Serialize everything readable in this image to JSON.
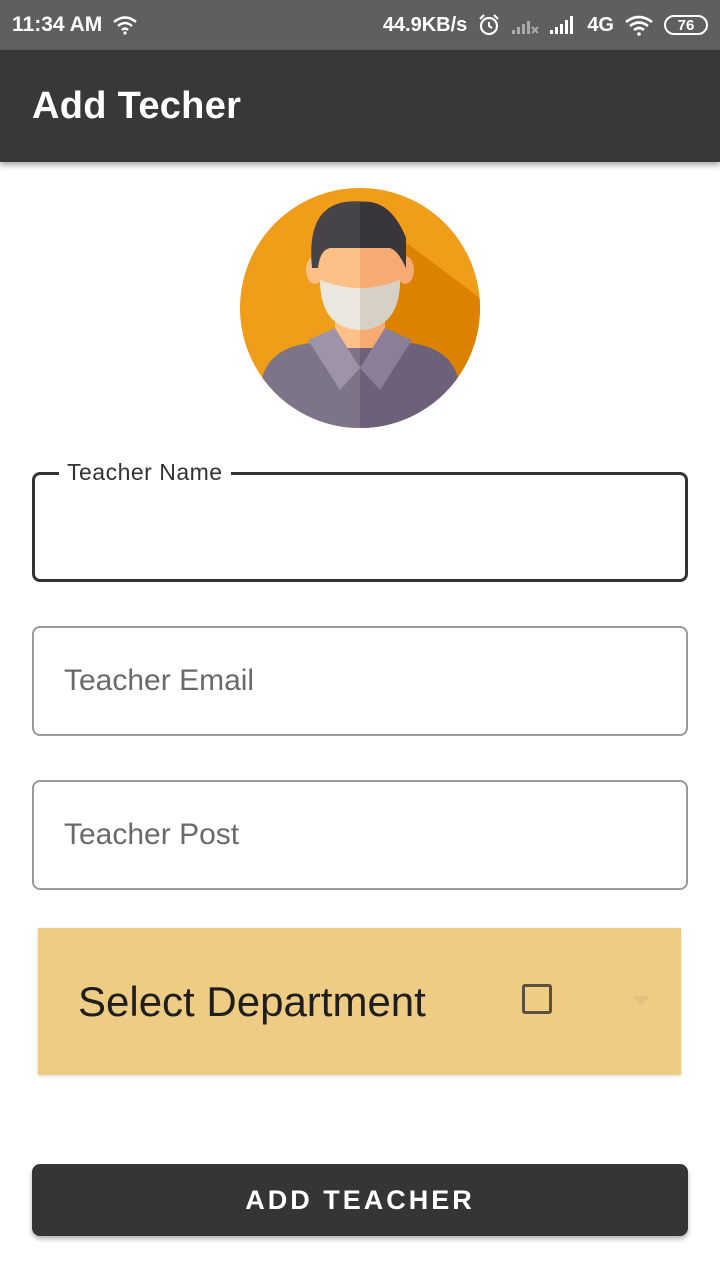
{
  "status_bar": {
    "time": "11:34 AM",
    "speed": "44.9KB/s",
    "network": "4G",
    "battery": "76",
    "icons": [
      "wifi-icon",
      "alarm-icon",
      "signal-weak-icon",
      "signal-strong-icon",
      "wifi-icon"
    ]
  },
  "app_bar": {
    "title": "Add Techer"
  },
  "avatar": {
    "icon": "teacher-avatar-icon",
    "bg_color": "#f09d19",
    "shade_color": "#dc8200"
  },
  "form": {
    "name": {
      "label": "Teacher Name",
      "value": ""
    },
    "email": {
      "placeholder": "Teacher Email",
      "value": ""
    },
    "post": {
      "placeholder": "Teacher Post",
      "value": ""
    }
  },
  "department": {
    "label": "Select Department",
    "bg_color": "#eecc84",
    "checked": false
  },
  "submit": {
    "label": "ADD TEACHER"
  },
  "colors": {
    "app_bar": "#373837",
    "status_bar": "#5f605e",
    "button": "#343534"
  }
}
